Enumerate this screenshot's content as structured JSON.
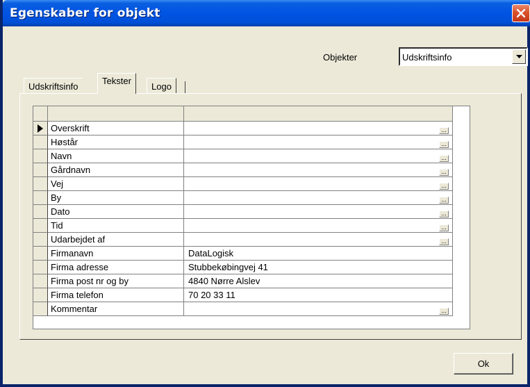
{
  "window": {
    "title": "Egenskaber for objekt"
  },
  "objekter": {
    "label": "Objekter",
    "selected": "Udskriftsinfo"
  },
  "tabs": [
    {
      "label": "Udskriftsinfo",
      "active": false
    },
    {
      "label": "Tekster",
      "active": true
    },
    {
      "label": "Logo",
      "active": false
    }
  ],
  "grid": {
    "rows": [
      {
        "name": "Overskrift",
        "value": "",
        "has_button": true,
        "selected": true
      },
      {
        "name": "Høstår",
        "value": "",
        "has_button": true
      },
      {
        "name": "Navn",
        "value": "",
        "has_button": true
      },
      {
        "name": "Gårdnavn",
        "value": "",
        "has_button": true
      },
      {
        "name": "Vej",
        "value": "",
        "has_button": true
      },
      {
        "name": "By",
        "value": "",
        "has_button": true
      },
      {
        "name": "Dato",
        "value": "",
        "has_button": true
      },
      {
        "name": "Tid",
        "value": "",
        "has_button": true
      },
      {
        "name": "Udarbejdet af",
        "value": "",
        "has_button": true
      },
      {
        "name": "Firmanavn",
        "value": "DataLogisk",
        "has_button": false
      },
      {
        "name": "Firma adresse",
        "value": "Stubbekøbingvej 41",
        "has_button": false
      },
      {
        "name": "Firma post nr og by",
        "value": "4840 Nørre Alslev",
        "has_button": false
      },
      {
        "name": "Firma telefon",
        "value": "70 20 33 11",
        "has_button": false
      },
      {
        "name": "Kommentar",
        "value": "",
        "has_button": true
      }
    ],
    "ellipsis": "..."
  },
  "buttons": {
    "ok_label": "Ok"
  }
}
